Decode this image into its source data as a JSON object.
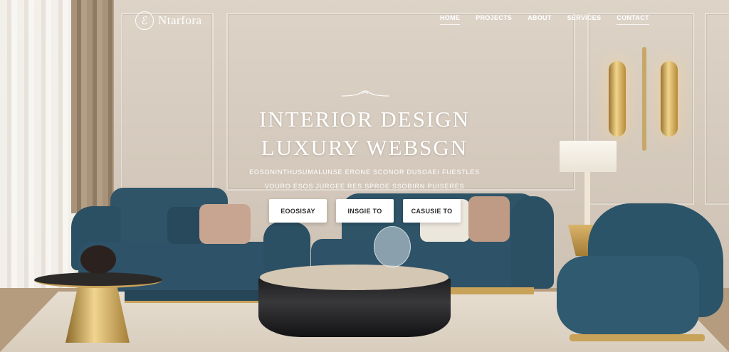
{
  "header": {
    "logo_mark": "ℰ",
    "logo_text": "Ntarfora"
  },
  "nav": {
    "items": [
      {
        "label": "HOME",
        "underlined": true
      },
      {
        "label": "PROJECTS",
        "underlined": false
      },
      {
        "label": "ABOUT",
        "underlined": false
      },
      {
        "label": "SERVICES",
        "underlined": false
      },
      {
        "label": "CONTACT",
        "underlined": true
      }
    ]
  },
  "hero": {
    "headline_line1": "INTERIOR DESIGN",
    "headline_line2": "LUXURY WEBSGN",
    "subtext_line1": "EOSONINTHUSUMALUNSE ERONE SCONOR DUSOAEI FUESTLES",
    "subtext_line2": "VOURO ESOS JURGEE RES SPROE SSOBIRN PUISERES",
    "buttons": [
      {
        "label": "EOOSISAY"
      },
      {
        "label": "INSGIE TO"
      },
      {
        "label": "CASUSIE TO"
      }
    ]
  },
  "colors": {
    "wall": "#d6ccbf",
    "velvet": "#2e5267",
    "brass": "#c9a25a",
    "button_bg": "#ffffff",
    "button_text": "#2a2a2a"
  }
}
